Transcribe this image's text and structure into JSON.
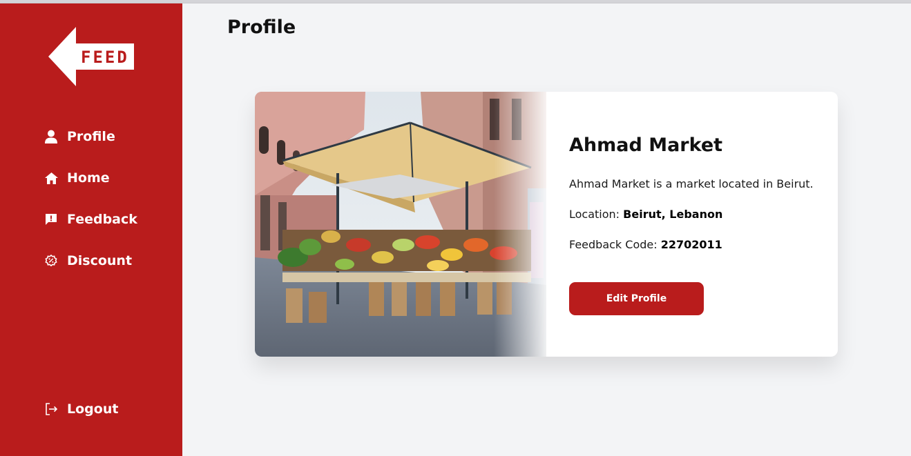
{
  "app": {
    "logo_text": "FEED"
  },
  "sidebar": {
    "items": [
      {
        "label": "Profile",
        "icon": "user-icon"
      },
      {
        "label": "Home",
        "icon": "home-icon"
      },
      {
        "label": "Feedback",
        "icon": "feedback-icon"
      },
      {
        "label": "Discount",
        "icon": "discount-icon"
      }
    ],
    "logout": {
      "label": "Logout",
      "icon": "logout-icon"
    }
  },
  "main": {
    "title": "Profile",
    "card": {
      "name": "Ahmad Market",
      "description": "Ahmad Market is a market located in Beirut.",
      "location_label": "Location:",
      "location_value": "Beirut, Lebanon",
      "code_label": "Feedback Code:",
      "code_value": "22702011",
      "edit_button": "Edit Profile"
    }
  },
  "colors": {
    "brand": "#b91c1c",
    "background": "#f3f4f6",
    "card": "#ffffff"
  }
}
